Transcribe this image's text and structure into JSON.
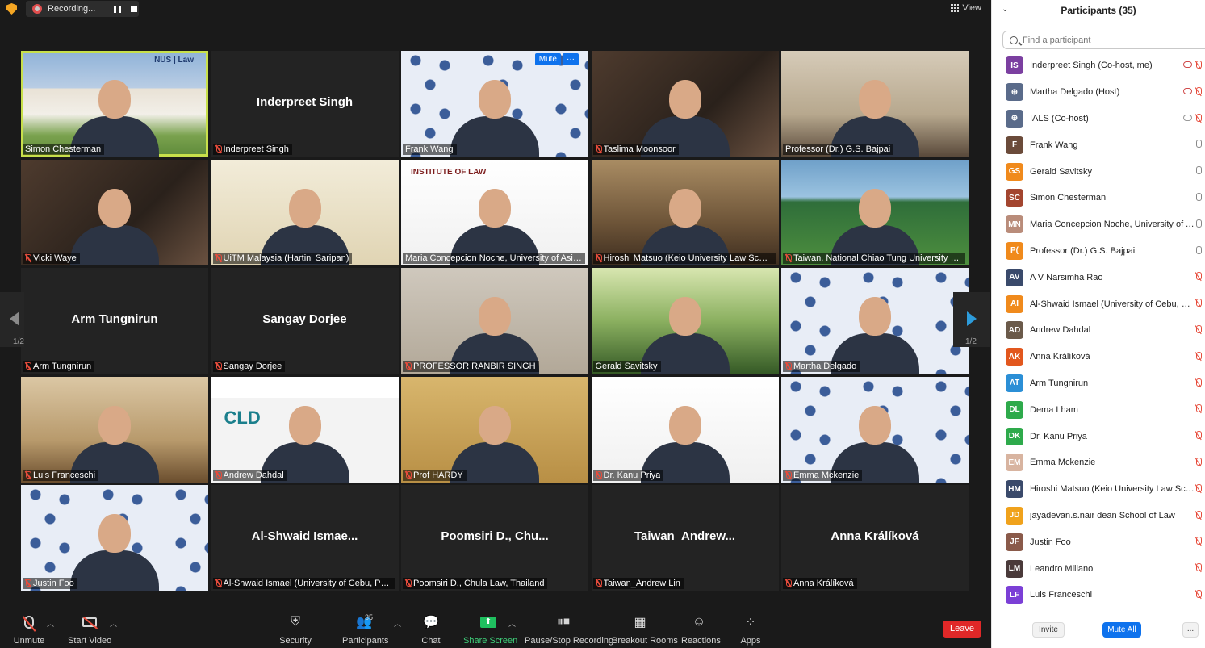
{
  "recording": {
    "label": "Recording..."
  },
  "view_button": {
    "label": "View"
  },
  "page_indicator": "1/2",
  "tiles": [
    {
      "name": "Simon Chesterman",
      "style": "v-campus",
      "video": true,
      "muted": false,
      "active": true,
      "logo": "NUS | Law"
    },
    {
      "name": "Inderpreet Singh",
      "big": "Inderpreet Singh",
      "video": false,
      "muted": true
    },
    {
      "name": "Frank Wang",
      "style": "v-logo-bg",
      "video": true,
      "muted": false,
      "hover": true
    },
    {
      "name": "Taslima Moonsoor",
      "style": "v-room-dark",
      "video": true,
      "muted": true
    },
    {
      "name": "Professor (Dr.) G.S. Bajpai",
      "style": "v-office",
      "video": true,
      "muted": false
    },
    {
      "name": "Vicki Waye",
      "style": "v-room-dark",
      "video": true,
      "muted": true
    },
    {
      "name": "UiTM Malaysia (Hartini Saripan)",
      "style": "v-beige",
      "video": true,
      "muted": true
    },
    {
      "name": "Maria Concepcion Noche, University of Asia a...",
      "style": "v-white",
      "video": true,
      "muted": false,
      "logo2": "INSTITUTE OF LAW"
    },
    {
      "name": "Hiroshi Matsuo (Keio University Law School...",
      "style": "v-hall",
      "video": true,
      "muted": true
    },
    {
      "name": "Taiwan, National Chiao Tung University Sch...",
      "style": "v-green",
      "video": true,
      "muted": true
    },
    {
      "name": "Arm Tungnirun",
      "big": "Arm Tungnirun",
      "video": false,
      "muted": true
    },
    {
      "name": "Sangay Dorjee",
      "big": "Sangay Dorjee",
      "video": false,
      "muted": true
    },
    {
      "name": "PROFESSOR RANBIR SINGH",
      "style": "v-wall",
      "video": true,
      "muted": true
    },
    {
      "name": "Gerald Savitsky",
      "style": "v-park",
      "video": true,
      "muted": false
    },
    {
      "name": "Martha Delgado",
      "style": "v-logo-bg",
      "video": true,
      "muted": true
    },
    {
      "name": "Luis Franceschi",
      "style": "v-wood",
      "video": true,
      "muted": true
    },
    {
      "name": "Andrew Dahdal",
      "style": "v-cld",
      "video": true,
      "muted": true,
      "cld": "CLD"
    },
    {
      "name": "Prof HARDY",
      "style": "v-yellow",
      "video": true,
      "muted": true
    },
    {
      "name": "Dr. Kanu Priya",
      "style": "v-white",
      "video": true,
      "muted": true
    },
    {
      "name": "Emma Mckenzie",
      "style": "v-logo-bg",
      "video": true,
      "muted": true
    },
    {
      "name": "Justin Foo",
      "style": "v-logo-bg",
      "video": true,
      "muted": true
    },
    {
      "name": "Al-Shwaid Ismael (University of Cebu, Philip...",
      "big": "Al-Shwaid  Ismae...",
      "video": false,
      "muted": true
    },
    {
      "name": "Poomsiri D., Chula Law, Thailand",
      "big": "Poomsiri D., Chu...",
      "video": false,
      "muted": true
    },
    {
      "name": "Taiwan_Andrew Lin",
      "big": "Taiwan_Andrew...",
      "video": false,
      "muted": true
    },
    {
      "name": "Anna Králíková",
      "big": "Anna Králíková",
      "video": false,
      "muted": true
    }
  ],
  "hover_controls": {
    "mute": "Mute",
    "more": "···"
  },
  "toolbar": {
    "unmute": "Unmute",
    "start_video": "Start Video",
    "security": "Security",
    "participants": "Participants",
    "participants_count": "35",
    "chat": "Chat",
    "share_screen": "Share Screen",
    "pause_stop_recording": "Pause/Stop Recording",
    "breakout_rooms": "Breakout Rooms",
    "reactions": "Reactions",
    "apps": "Apps",
    "leave": "Leave"
  },
  "panel": {
    "title": "Participants (35)",
    "search_placeholder": "Find a participant",
    "invite": "Invite",
    "mute_all": "Mute All",
    "more": "...",
    "participants": [
      {
        "initials": "IS",
        "color": "#7b3fa0",
        "name": "Inderpreet Singh (Co-host, me)",
        "mic": "off",
        "cloud": "red"
      },
      {
        "initials": "⊕",
        "color": "#5a6b8a",
        "name": "Martha Delgado (Host)",
        "mic": "off",
        "cloud": "red"
      },
      {
        "initials": "⊕",
        "color": "#5a6b8a",
        "name": "IALS (Co-host)",
        "mic": "off",
        "cloud": "gray"
      },
      {
        "initials": "F",
        "color": "#6b4b3a",
        "name": "Frank Wang",
        "mic": "on"
      },
      {
        "initials": "GS",
        "color": "#f08a1c",
        "name": "Gerald Savitsky",
        "mic": "on"
      },
      {
        "initials": "SC",
        "color": "#a3452f",
        "name": "Simon Chesterman",
        "mic": "on"
      },
      {
        "initials": "MN",
        "color": "#b98c7a",
        "name": "Maria Concepcion Noche, University of As...",
        "mic": "on"
      },
      {
        "initials": "P(",
        "color": "#f08a1c",
        "name": "Professor (Dr.) G.S. Bajpai",
        "mic": "on"
      },
      {
        "initials": "AV",
        "color": "#3a4a6b",
        "name": "A V Narsimha Rao",
        "mic": "off"
      },
      {
        "initials": "AI",
        "color": "#f08a1c",
        "name": "Al-Shwaid Ismael (University of Cebu, Phili...",
        "mic": "off"
      },
      {
        "initials": "AD",
        "color": "#6b5a4a",
        "name": "Andrew Dahdal",
        "mic": "off"
      },
      {
        "initials": "AK",
        "color": "#e2571e",
        "name": "Anna Králíková",
        "mic": "off"
      },
      {
        "initials": "AT",
        "color": "#2b8fd6",
        "name": "Arm Tungnirun",
        "mic": "off"
      },
      {
        "initials": "DL",
        "color": "#2eaa4b",
        "name": "Dema Lham",
        "mic": "off"
      },
      {
        "initials": "DK",
        "color": "#2eaa4b",
        "name": "Dr. Kanu Priya",
        "mic": "off"
      },
      {
        "initials": "EM",
        "color": "#d8b4a0",
        "name": "Emma Mckenzie",
        "mic": "off"
      },
      {
        "initials": "HM",
        "color": "#3a4a6b",
        "name": "Hiroshi Matsuo (Keio University Law Scho...",
        "mic": "off"
      },
      {
        "initials": "JD",
        "color": "#f0a21c",
        "name": "jayadevan.s.nair dean School of Law",
        "mic": "off"
      },
      {
        "initials": "JF",
        "color": "#8a5a4a",
        "name": "Justin Foo",
        "mic": "off"
      },
      {
        "initials": "LM",
        "color": "#4a3a3a",
        "name": "Leandro Millano",
        "mic": "off"
      },
      {
        "initials": "LF",
        "color": "#7b3fd6",
        "name": "Luis Franceschi",
        "mic": "off"
      }
    ]
  }
}
